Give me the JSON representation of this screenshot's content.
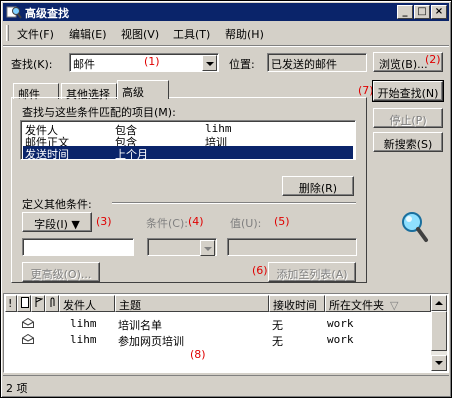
{
  "window": {
    "title": "高级查找",
    "controls": {
      "minimize": "_",
      "maximize": "□",
      "close": "×"
    }
  },
  "menu": [
    {
      "label": "文件",
      "key": "(F)"
    },
    {
      "label": "编辑",
      "key": "(E)"
    },
    {
      "label": "视图",
      "key": "(V)"
    },
    {
      "label": "工具",
      "key": "(T)"
    },
    {
      "label": "帮助",
      "key": "(H)"
    }
  ],
  "search": {
    "find_label": "查找(K):",
    "find_value": "邮件",
    "location_label": "位置:",
    "location_value": "已发送的邮件",
    "browse_button": "浏览(B)..."
  },
  "tabs": [
    "邮件",
    "其他选择",
    "高级"
  ],
  "advanced": {
    "criteria_label": "查找与这些条件匹配的项目(M):",
    "criteria": [
      {
        "field": "发件人",
        "condition": "包含",
        "value": "lihm",
        "selected": false
      },
      {
        "field": "邮件正文",
        "condition": "包含",
        "value": "培训",
        "selected": false
      },
      {
        "field": "发送时间",
        "condition": "上个月",
        "value": "",
        "selected": true
      }
    ],
    "remove_button": "删除(R)",
    "define_more_label": "定义其他条件:",
    "field_button": "字段(I) ▼",
    "condition_label": "条件(C):",
    "value_label": "值(U):",
    "more_advanced_button": "更高级(O)...",
    "add_to_list_button": "添加至列表(A)"
  },
  "actions": {
    "find_now": "开始查找(N)",
    "stop": "停止(P)",
    "new_search": "新搜索(S)"
  },
  "annotations": [
    "(1)",
    "(2)",
    "(3)",
    "(4)",
    "(5)",
    "(6)",
    "(7)",
    "(8)"
  ],
  "results": {
    "columns": [
      "!",
      "发件人",
      "主题",
      "接收时间",
      "所在文件夹"
    ],
    "rows": [
      {
        "from": "lihm",
        "subject": "培训名单",
        "received": "无",
        "folder": "work"
      },
      {
        "from": "lihm",
        "subject": "参加网页培训",
        "received": "无",
        "folder": "work"
      }
    ]
  },
  "status": {
    "count": "2 项"
  },
  "colors": {
    "titlebar": "#0a246a",
    "face": "#d4d0c8",
    "annotation": "#e00000",
    "selection": "#0a246a"
  }
}
